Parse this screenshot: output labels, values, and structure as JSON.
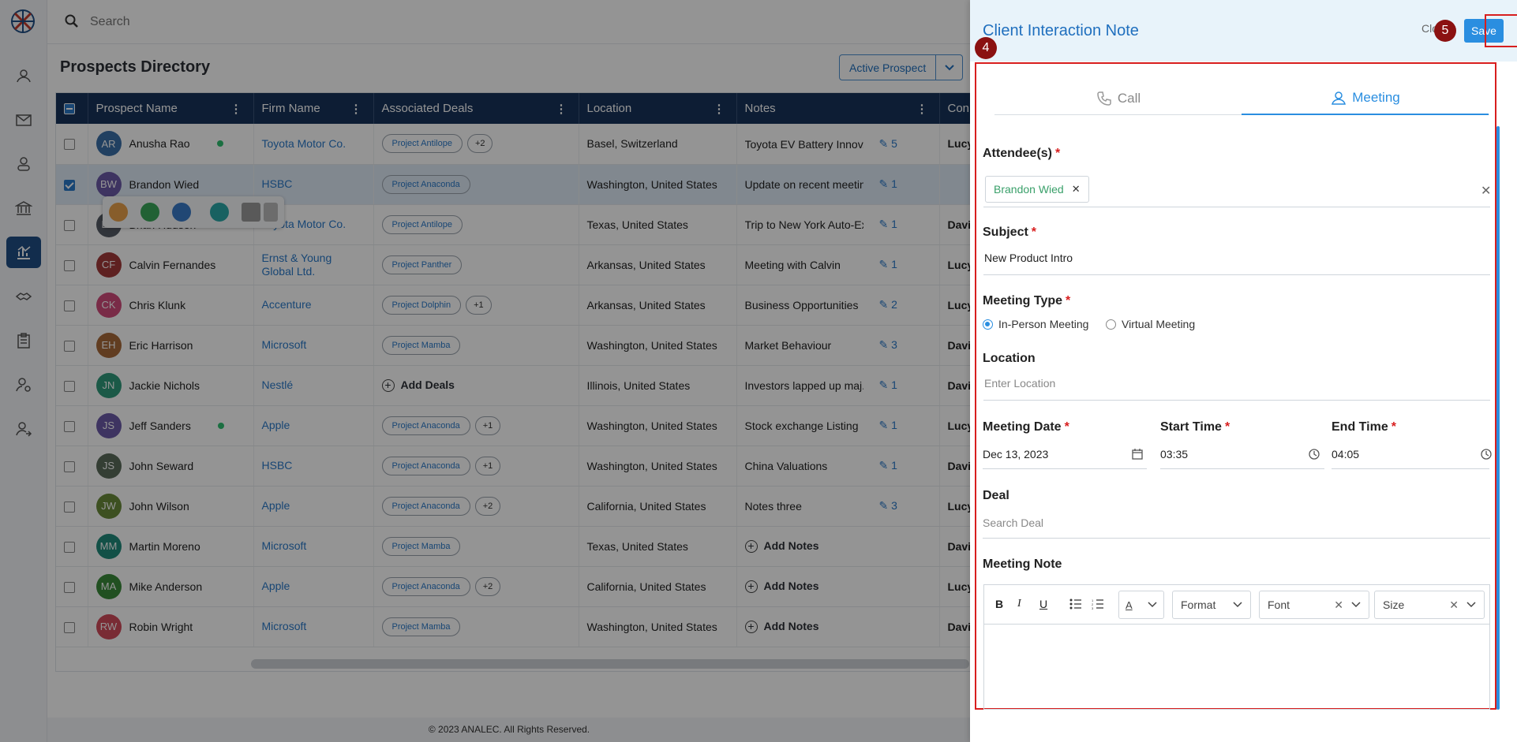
{
  "search": {
    "placeholder": "Search"
  },
  "page": {
    "title": "Prospects Directory",
    "filter_label": "Active Prospect"
  },
  "table": {
    "columns": [
      "Prospect Name",
      "Firm Name",
      "Associated Deals",
      "Location",
      "Notes",
      "Conn"
    ],
    "rows": [
      {
        "initials": "AR",
        "color": "#3a6fa8",
        "name": "Anusha Rao",
        "online": true,
        "firm": "Toyota Motor Co.",
        "deals": [
          "Project Antilope"
        ],
        "more": "+2",
        "location": "Basel, Switzerland",
        "note": "Toyota EV Battery Innov...",
        "note_count": "5",
        "owner": "Lucy"
      },
      {
        "initials": "BW",
        "color": "#6b5aa8",
        "name": "Brandon Wied",
        "online": false,
        "firm": "HSBC",
        "deals": [
          "Project Anaconda"
        ],
        "more": "",
        "location": "Washington, United States",
        "note": "Update on recent meetin...",
        "note_count": "1",
        "owner": "",
        "selected": true
      },
      {
        "initials": "BH",
        "color": "#555c66",
        "name": "Brian Hudson",
        "online": false,
        "firm": "Toyota Motor Co.",
        "deals": [
          "Project Antilope"
        ],
        "more": "",
        "location": "Texas, United States",
        "note": "Trip to New York Auto-Ex...",
        "note_count": "1",
        "owner": "David"
      },
      {
        "initials": "CF",
        "color": "#a33a3a",
        "name": "Calvin Fernandes",
        "online": false,
        "firm": "Ernst & Young Global Ltd.",
        "deals": [
          "Project Panther"
        ],
        "more": "",
        "location": "Arkansas, United States",
        "note": "Meeting with Calvin",
        "note_count": "1",
        "owner": "Lucy"
      },
      {
        "initials": "CK",
        "color": "#d04a7a",
        "name": "Chris Klunk",
        "online": false,
        "firm": "Accenture",
        "deals": [
          "Project Dolphin"
        ],
        "more": "+1",
        "location": "Arkansas, United States",
        "note": "Business Opportunities",
        "note_count": "2",
        "owner": "Lucy"
      },
      {
        "initials": "EH",
        "color": "#a86a3a",
        "name": "Eric Harrison",
        "online": false,
        "firm": "Microsoft",
        "deals": [
          "Project Mamba"
        ],
        "more": "",
        "location": "Washington, United States",
        "note": "Market Behaviour",
        "note_count": "3",
        "owner": "David"
      },
      {
        "initials": "JN",
        "color": "#2f9a7a",
        "name": "Jackie Nichols",
        "online": false,
        "firm": "Nestlé",
        "deals": [],
        "more": "",
        "add_deals": "Add Deals",
        "location": "Illinois, United States",
        "note": "Investors lapped up maj...",
        "note_count": "1",
        "owner": "David"
      },
      {
        "initials": "JS",
        "color": "#6b5aa8",
        "name": "Jeff Sanders",
        "online": true,
        "firm": "Apple",
        "deals": [
          "Project Anaconda"
        ],
        "more": "+1",
        "location": "Washington, United States",
        "note": "Stock exchange Listing",
        "note_count": "1",
        "owner": "Lucy"
      },
      {
        "initials": "JS",
        "color": "#5a6b5a",
        "name": "John Seward",
        "online": false,
        "firm": "HSBC",
        "deals": [
          "Project Anaconda"
        ],
        "more": "+1",
        "location": "Washington, United States",
        "note": "China Valuations",
        "note_count": "1",
        "owner": "David"
      },
      {
        "initials": "JW",
        "color": "#6a8a3a",
        "name": "John Wilson",
        "online": false,
        "firm": "Apple",
        "deals": [
          "Project Anaconda"
        ],
        "more": "+2",
        "location": "California, United States",
        "note": "Notes three",
        "note_count": "3",
        "owner": "Lucy"
      },
      {
        "initials": "MM",
        "color": "#1f8a7a",
        "name": "Martin Moreno",
        "online": false,
        "firm": "Microsoft",
        "deals": [
          "Project Mamba"
        ],
        "more": "",
        "location": "Texas, United States",
        "note": "",
        "add_notes": "Add Notes",
        "note_count": "",
        "owner": "David"
      },
      {
        "initials": "MA",
        "color": "#3a8a3a",
        "name": "Mike Anderson",
        "online": false,
        "firm": "Apple",
        "deals": [
          "Project Anaconda"
        ],
        "more": "+2",
        "location": "California, United States",
        "note": "",
        "add_notes": "Add Notes",
        "note_count": "",
        "owner": "Lucy"
      },
      {
        "initials": "RW",
        "color": "#d04a5a",
        "name": "Robin Wright",
        "online": false,
        "firm": "Microsoft",
        "deals": [
          "Project Mamba"
        ],
        "more": "",
        "location": "Washington, United States",
        "note": "",
        "add_notes": "Add Notes",
        "note_count": "",
        "owner": "David"
      }
    ]
  },
  "footer": {
    "text": "© 2023 ANALEC. All Rights Reserved."
  },
  "panel": {
    "title": "Client Interaction Note",
    "close_label": "Close",
    "save_label": "Save",
    "badge_form": "4",
    "badge_save": "5",
    "tabs": {
      "call": "Call",
      "meeting": "Meeting"
    },
    "attendees": {
      "label": "Attendee(s)",
      "chip": "Brandon Wied"
    },
    "subject": {
      "label": "Subject",
      "value": "New Product Intro"
    },
    "meeting_type": {
      "label": "Meeting Type",
      "option_in_person": "In-Person Meeting",
      "option_virtual": "Virtual Meeting",
      "selected": "In-Person Meeting"
    },
    "location": {
      "label": "Location",
      "placeholder": "Enter Location"
    },
    "meeting_date": {
      "label": "Meeting Date",
      "value": "Dec 13, 2023"
    },
    "start_time": {
      "label": "Start Time",
      "value": "03:35"
    },
    "end_time": {
      "label": "End Time",
      "value": "04:05"
    },
    "deal": {
      "label": "Deal",
      "placeholder": "Search Deal"
    },
    "meeting_note": {
      "label": "Meeting Note",
      "format": "Format",
      "font": "Font",
      "size": "Size",
      "bold": "B",
      "italic": "I",
      "underline": "U",
      "color_letter": "A"
    }
  },
  "colors": {
    "accent": "#2a8ee0",
    "highlight": "#d81e1e",
    "header_bg": "#17335a",
    "badge": "#8b1111"
  }
}
